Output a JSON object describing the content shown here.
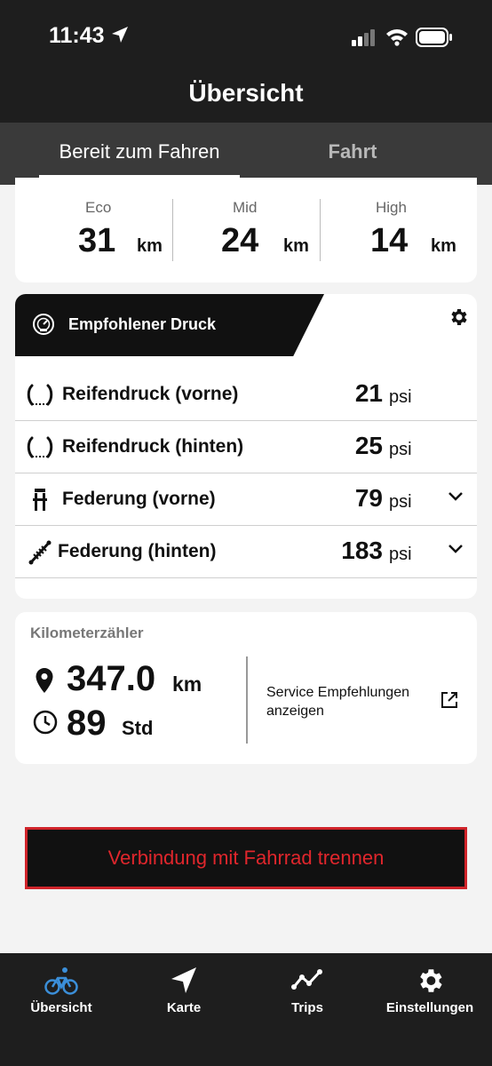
{
  "status_bar": {
    "time": "11:43"
  },
  "header": {
    "title": "Übersicht"
  },
  "tabs": [
    {
      "label": "Bereit zum Fahren",
      "active": true
    },
    {
      "label": "Fahrt",
      "active": false
    }
  ],
  "range": {
    "modes": [
      {
        "label": "Eco",
        "value": "31",
        "unit": "km"
      },
      {
        "label": "Mid",
        "value": "24",
        "unit": "km"
      },
      {
        "label": "High",
        "value": "14",
        "unit": "km"
      }
    ]
  },
  "pressure": {
    "title": "Empfohlener Druck",
    "rows": [
      {
        "label": "Reifendruck (vorne)",
        "value": "21",
        "unit": "psi",
        "icon": "tire-icon",
        "expandable": false
      },
      {
        "label": "Reifendruck (hinten)",
        "value": "25",
        "unit": "psi",
        "icon": "tire-icon",
        "expandable": false
      },
      {
        "label": "Federung (vorne)",
        "value": "79",
        "unit": "psi",
        "icon": "fork-icon",
        "expandable": true
      },
      {
        "label": "Federung (hinten)",
        "value": "183",
        "unit": "psi",
        "icon": "shock-icon",
        "expandable": true
      }
    ]
  },
  "odometer": {
    "title": "Kilometerzähler",
    "distance": "347.0",
    "distance_unit": "km",
    "hours": "89",
    "hours_unit": "Std",
    "service_link": "Service Empfehlungen anzeigen"
  },
  "disconnect_button": "Verbindung mit Fahrrad trennen",
  "bottom_nav": [
    {
      "label": "Übersicht",
      "icon": "bike-icon",
      "active": true
    },
    {
      "label": "Karte",
      "icon": "navigation-arrow-icon",
      "active": false
    },
    {
      "label": "Trips",
      "icon": "trips-chart-icon",
      "active": false
    },
    {
      "label": "Einstellungen",
      "icon": "gear-icon",
      "active": false
    }
  ],
  "colors": {
    "header_bg": "#1e1e1e",
    "tab_bg": "#3a3a3a",
    "accent_blue": "#3b8fd9",
    "danger_red": "#d0242a"
  }
}
